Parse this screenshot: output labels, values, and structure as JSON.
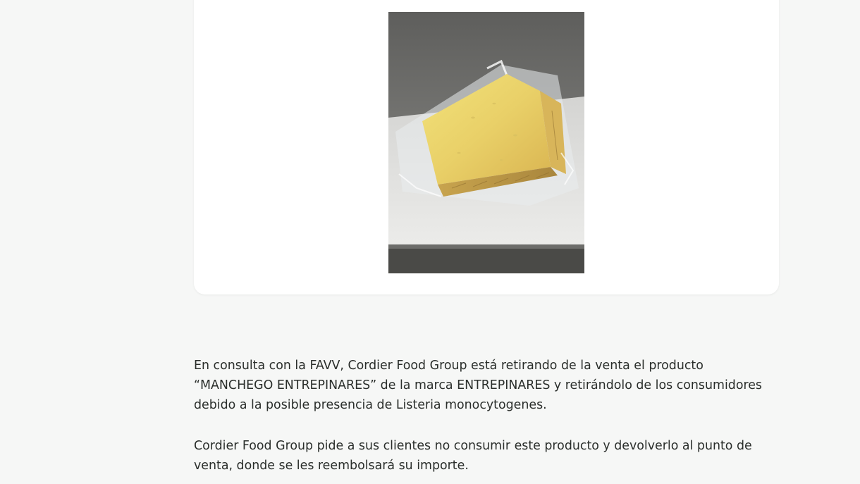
{
  "article": {
    "paragraphs": [
      "En consulta con la FAVV, Cordier Food Group está retirando de la venta el producto “MANCHEGO ENTREPINARES” de la marca ENTREPINARES y retirándolo de los consumidores debido a la posible presencia de Listeria monocytogenes.",
      "Cordier Food Group pide a sus clientes no consumir este producto y devolverlo al punto de venta, donde se les reembolsará su importe."
    ]
  },
  "colors": {
    "page_background": "#f6f7f6",
    "card_background": "#ffffff",
    "text": "#2a2e2b"
  }
}
